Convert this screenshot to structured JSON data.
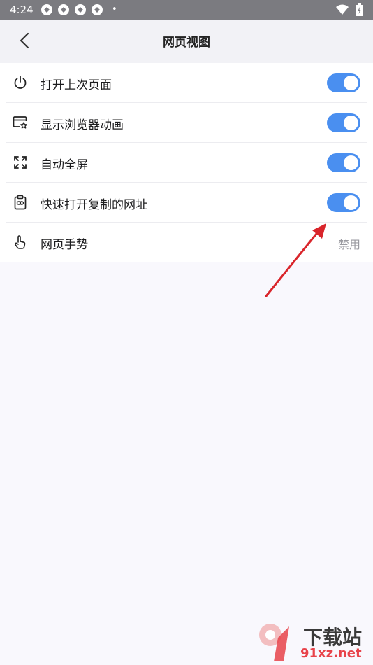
{
  "status_bar": {
    "time": "4:24",
    "dot": "•"
  },
  "header": {
    "title": "网页视图"
  },
  "settings": [
    {
      "label": "打开上次页面",
      "icon": "power-icon",
      "toggle": true
    },
    {
      "label": "显示浏览器动画",
      "icon": "browser-star-icon",
      "toggle": true
    },
    {
      "label": "自动全屏",
      "icon": "fullscreen-icon",
      "toggle": true
    },
    {
      "label": "快速打开复制的网址",
      "icon": "clipboard-link-icon",
      "toggle": true
    },
    {
      "label": "网页手势",
      "icon": "gesture-hand-icon",
      "value": "禁用"
    }
  ],
  "colors": {
    "accent": "#4a8ff0",
    "arrow": "#d9252b"
  },
  "watermark": {
    "brand": "下载站",
    "domain": "91xz.net"
  }
}
